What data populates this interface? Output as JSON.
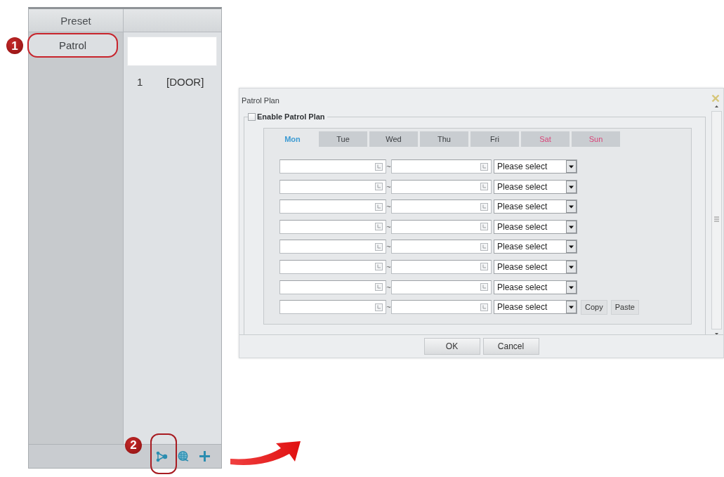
{
  "preset_panel": {
    "header": "Preset",
    "items": [
      {
        "label": "Patrol",
        "selected": true,
        "highlighted": true,
        "callout": "1"
      }
    ]
  },
  "patrol_panel": {
    "rows": [
      {
        "index": "1",
        "name": "[DOOR]"
      }
    ]
  },
  "toolbar": {
    "tools": [
      {
        "kind": "route",
        "highlighted": true,
        "callout": "2"
      },
      {
        "kind": "globe",
        "highlighted": false
      },
      {
        "kind": "add",
        "highlighted": false
      }
    ]
  },
  "dialog": {
    "title": "Patrol Plan",
    "enable_checkbox": {
      "label": "Enable Patrol Plan",
      "checked": false
    },
    "tabs": [
      {
        "label": "Mon",
        "selected": true,
        "weekend": false
      },
      {
        "label": "Tue",
        "selected": false,
        "weekend": false
      },
      {
        "label": "Wed",
        "selected": false,
        "weekend": false
      },
      {
        "label": "Thu",
        "selected": false,
        "weekend": false
      },
      {
        "label": "Fri",
        "selected": false,
        "weekend": false
      },
      {
        "label": "Sat",
        "selected": false,
        "weekend": true
      },
      {
        "label": "Sun",
        "selected": false,
        "weekend": true
      }
    ],
    "rows": [
      {
        "separator": "~",
        "preset": "Please select"
      },
      {
        "separator": "~",
        "preset": "Please select"
      },
      {
        "separator": "~",
        "preset": "Please select"
      },
      {
        "separator": "~",
        "preset": "Please select"
      },
      {
        "separator": "~",
        "preset": "Please select"
      },
      {
        "separator": "~",
        "preset": "Please select"
      },
      {
        "separator": "~",
        "preset": "Please select"
      },
      {
        "separator": "~",
        "preset": "Please select",
        "actions": [
          "Copy",
          "Paste"
        ]
      }
    ],
    "buttons": [
      "OK",
      "Cancel"
    ]
  }
}
